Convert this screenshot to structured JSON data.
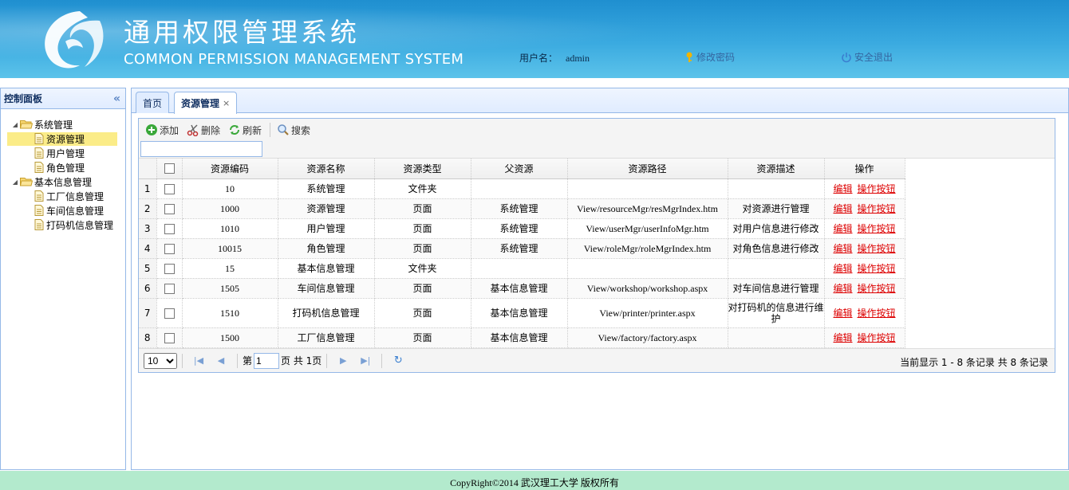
{
  "header": {
    "title_cn": "通用权限管理系统",
    "title_en": "COMMON PERMISSION MANAGEMENT SYSTEM",
    "user_label": "用户名：",
    "username": "admin",
    "change_password": "修改密码",
    "logout": "安全退出"
  },
  "left": {
    "title": "控制面板",
    "tree": {
      "group1": "系统管理",
      "g1_items": [
        "资源管理",
        "用户管理",
        "角色管理"
      ],
      "group2": "基本信息管理",
      "g2_items": [
        "工厂信息管理",
        "车间信息管理",
        "打码机信息管理"
      ]
    }
  },
  "tabs": [
    "首页",
    "资源管理"
  ],
  "toolbar": {
    "add": "添加",
    "delete": "删除",
    "refresh": "刷新",
    "search": "搜索"
  },
  "search": {
    "value": ""
  },
  "table": {
    "headers": [
      "资源编码",
      "资源名称",
      "资源类型",
      "父资源",
      "资源路径",
      "资源描述",
      "操作"
    ],
    "rows": [
      {
        "n": "1",
        "code": "10",
        "name": "系统管理",
        "type": "文件夹",
        "parent": "",
        "path": "",
        "desc": ""
      },
      {
        "n": "2",
        "code": "1000",
        "name": "资源管理",
        "type": "页面",
        "parent": "系统管理",
        "path": "View/resourceMgr/resMgrIndex.htm",
        "desc": "对资源进行管理"
      },
      {
        "n": "3",
        "code": "1010",
        "name": "用户管理",
        "type": "页面",
        "parent": "系统管理",
        "path": "View/userMgr/userInfoMgr.htm",
        "desc": "对用户信息进行修改"
      },
      {
        "n": "4",
        "code": "10015",
        "name": "角色管理",
        "type": "页面",
        "parent": "系统管理",
        "path": "View/roleMgr/roleMgrIndex.htm",
        "desc": "对角色信息进行修改"
      },
      {
        "n": "5",
        "code": "15",
        "name": "基本信息管理",
        "type": "文件夹",
        "parent": "",
        "path": "",
        "desc": ""
      },
      {
        "n": "6",
        "code": "1505",
        "name": "车间信息管理",
        "type": "页面",
        "parent": "基本信息管理",
        "path": "View/workshop/workshop.aspx",
        "desc": "对车间信息进行管理"
      },
      {
        "n": "7",
        "code": "1510",
        "name": "打码机信息管理",
        "type": "页面",
        "parent": "基本信息管理",
        "path": "View/printer/printer.aspx",
        "desc": "对打码机的信息进行维护"
      },
      {
        "n": "8",
        "code": "1500",
        "name": "工厂信息管理",
        "type": "页面",
        "parent": "基本信息管理",
        "path": "View/factory/factory.aspx",
        "desc": ""
      }
    ],
    "edit": "编辑",
    "op_buttons": "操作按钮"
  },
  "pager": {
    "page_size": "10",
    "page_prefix": "第",
    "page": "1",
    "page_suffix": "页 共 1页",
    "info": "当前显示 1 - 8 条记录 共 8 条记录"
  },
  "footer": "CopyRight©2014 武汉理工大学 版权所有"
}
